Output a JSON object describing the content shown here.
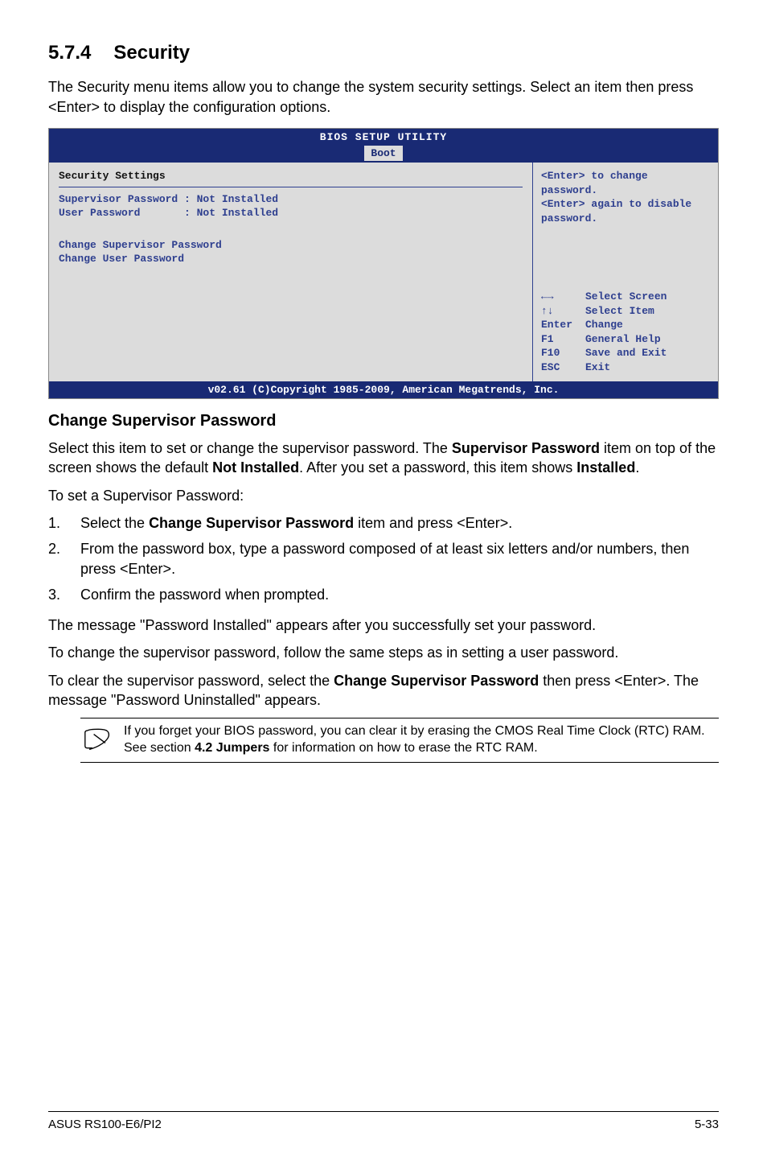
{
  "section": {
    "number": "5.7.4",
    "title": "Security"
  },
  "intro": "The Security menu items allow you to change the system security settings. Select an item then press <Enter> to display the configuration options.",
  "bios": {
    "title": "BIOS SETUP UTILITY",
    "tab": "Boot",
    "main": {
      "heading": "Security Settings",
      "line1": "Supervisor Password : Not Installed",
      "line2": "User Password       : Not Installed",
      "opt1": "Change Supervisor Password",
      "opt2": "Change User Password"
    },
    "side": {
      "help1": "<Enter> to change password.",
      "help2": "<Enter> again to disable password.",
      "nav": [
        {
          "key": "←→",
          "label": "Select Screen"
        },
        {
          "key": "↑↓",
          "label": "Select Item"
        },
        {
          "key": "Enter",
          "label": "Change"
        },
        {
          "key": "F1",
          "label": "General Help"
        },
        {
          "key": "F10",
          "label": "Save and Exit"
        },
        {
          "key": "ESC",
          "label": "Exit"
        }
      ]
    },
    "footer": "v02.61 (C)Copyright 1985-2009, American Megatrends, Inc."
  },
  "subheading": "Change Supervisor Password",
  "desc1a": "Select this item to set or change the supervisor password. The ",
  "desc1b": "Supervisor Password",
  "desc1c": " item on top of the screen shows the default ",
  "desc1d": "Not Installed",
  "desc1e": ". After you set a password, this item shows ",
  "desc1f": "Installed",
  "desc1g": ".",
  "toset": "To set a Supervisor Password:",
  "steps": [
    {
      "n": "1.",
      "pre": "Select the ",
      "bold": "Change Supervisor Password",
      "post": " item and press <Enter>."
    },
    {
      "n": "2.",
      "pre": "From the password box, type a password composed of at least six letters and/or numbers, then press <Enter>.",
      "bold": "",
      "post": ""
    },
    {
      "n": "3.",
      "pre": "Confirm the password when prompted.",
      "bold": "",
      "post": ""
    }
  ],
  "afterset": "The message \"Password Installed\" appears after you successfully set your password.",
  "changepw": "To change the supervisor password, follow the same steps as in setting a user password.",
  "clear_a": "To clear the supervisor password, select the ",
  "clear_b": "Change Supervisor Password",
  "clear_c": " then press <Enter>. The message \"Password Uninstalled\" appears.",
  "note_a": "If you forget your BIOS password, you can clear it by erasing the CMOS Real Time Clock (RTC) RAM. See section ",
  "note_b": "4.2 Jumpers",
  "note_c": " for information on how to erase the RTC RAM.",
  "footer": {
    "model": "ASUS RS100-E6/PI2",
    "page": "5-33"
  }
}
